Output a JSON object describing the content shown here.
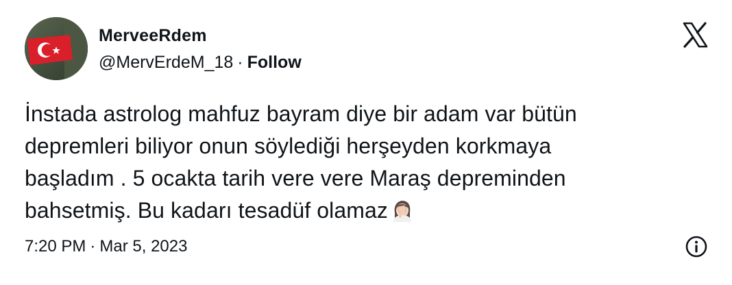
{
  "user": {
    "display_name": "MerveeRdem",
    "handle": "@MervErdeM_18",
    "separator": "·",
    "follow_label": "Follow",
    "avatar_icon": "turkish-flag-avatar"
  },
  "platform": {
    "logo_icon": "x-logo-icon"
  },
  "tweet": {
    "lines": [
      "İnstada astrolog mahfuz bayram diye bir adam var bütün",
      "depremleri biliyor onun söylediği herşeyden korkmaya",
      "başladım . 5 ocakta tarih vere vere Maraş depreminden",
      "bahsetmiş. Bu kadarı tesadüf olamaz"
    ],
    "emoji_icon": "woman-facepalming-emoji"
  },
  "meta": {
    "time": "7:20 PM",
    "separator": "·",
    "date": "Mar 5, 2023",
    "info_icon": "info-icon"
  },
  "colors": {
    "text": "#0f1419",
    "flag_red": "#d9202a",
    "background": "#ffffff"
  }
}
